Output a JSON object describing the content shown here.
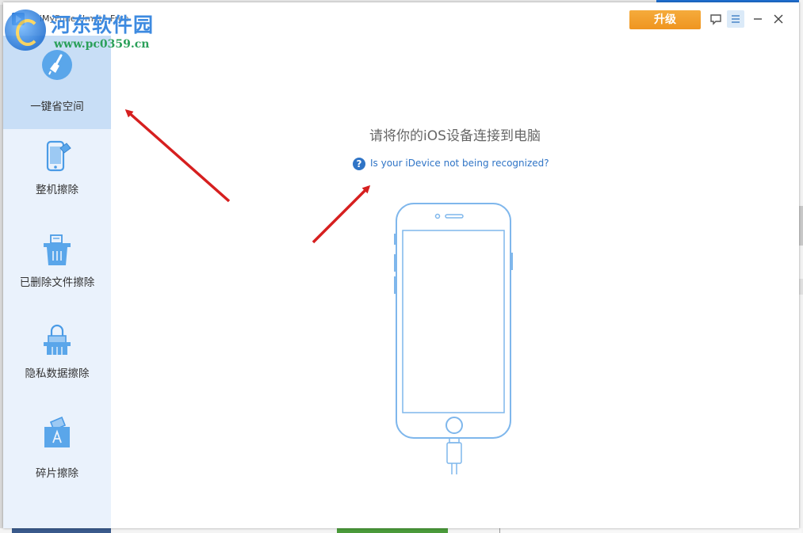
{
  "window": {
    "title": "iMyFone Umate Free",
    "upgrade_label": "升级",
    "accent_color": "#4a9be6",
    "upgrade_color": "#f29b27"
  },
  "watermark": {
    "title": "河东软件园",
    "url": "www.pc0359.cn"
  },
  "sidebar": {
    "items": [
      {
        "label": "一键省空间",
        "icon": "broom-icon",
        "active": true
      },
      {
        "label": "整机擦除",
        "icon": "phone-eraser-icon",
        "active": false
      },
      {
        "label": "已删除文件擦除",
        "icon": "trash-file-icon",
        "active": false
      },
      {
        "label": "隐私数据擦除",
        "icon": "lock-shredder-icon",
        "active": false
      },
      {
        "label": "碎片擦除",
        "icon": "app-shredder-icon",
        "active": false
      }
    ]
  },
  "main": {
    "prompt": "请将你的iOS设备连接到电脑",
    "help_link": "Is your iDevice not being recognized?"
  }
}
